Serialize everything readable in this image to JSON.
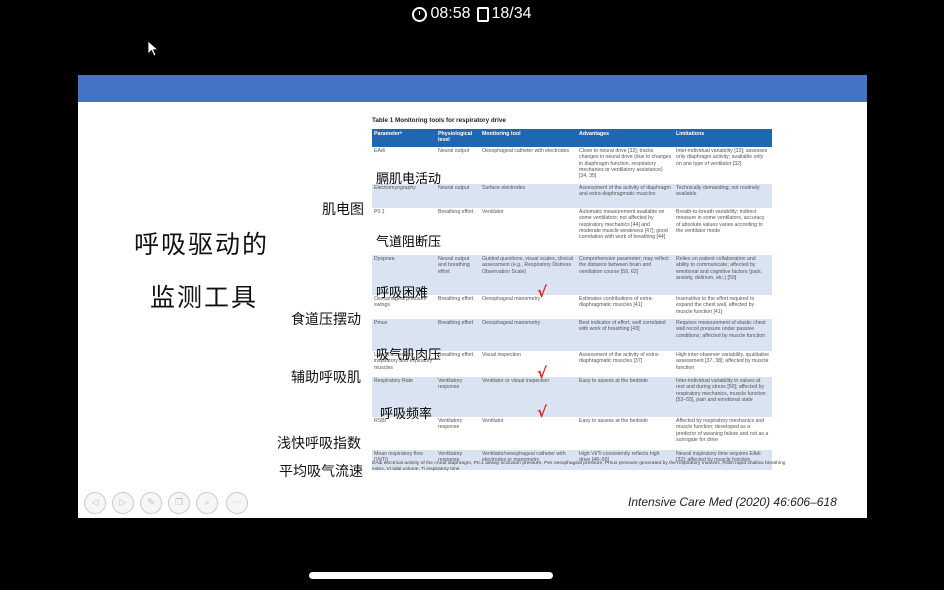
{
  "status": {
    "time": "08:58",
    "page": "18/34"
  },
  "slide": {
    "title_line1": "呼吸驱动的",
    "title_line2": "监测工具",
    "side_labels": [
      "肌电图",
      "食道压摆动",
      "辅助呼吸肌",
      "浅快呼吸指数",
      "平均吸气流速"
    ],
    "overlay_labels": [
      "膈肌电活动",
      "气道阻断压",
      "呼吸困难",
      "吸气肌肉压",
      "呼吸频率"
    ],
    "check_mark": "√",
    "citation": "Intensive Care Med (2020) 46:606–618"
  },
  "table": {
    "caption": "Table 1  Monitoring tools for respiratory drive",
    "headers": [
      "Parameterᵃ",
      "Physiological level",
      "Monitoring tool",
      "Advantages",
      "Limitations"
    ],
    "rows": [
      [
        "EAdi",
        "Neural output",
        "Oesophageal catheter with electrodes",
        "Close to neural drive [32]; tracks changes in neural drive (due to changes in diaphragm function, respiratory mechanics or ventilatory assistance) [34, 35]",
        "Inter-individual variability [33]; assesses only diaphragm activity; available only on one type of ventilator [32]"
      ],
      [
        "Electromyography",
        "Neural output",
        "Surface electrodes",
        "Assessment of the activity of diaphragm and extra-diaphragmatic muscles",
        "Technically demanding; not routinely available"
      ],
      [
        "P0.1",
        "Breathing effort",
        "Ventilator",
        "Automatic measurement available on some ventilators; not affected by respiratory mechanics [44] and moderate muscle weakness [47]; good correlation with work of breathing [44]",
        "Breath-to-breath variability; indirect measure in some ventilators, accuracy of absolute values varies according to the ventilator mode"
      ],
      [
        "Dyspnea",
        "Neural output and breathing effort",
        "Guided questions, visual scales, clinical assessment (e.g., Respiratory Distress Observation Scale)",
        "Comprehensive parameter; may reflect the distance between brain and ventilation course [59, 62]",
        "Relies on patient collaboration and ability to communicate; affected by emotional and cognitive factors (pain, anxiety, delirium, etc.) [59]"
      ],
      [
        "Oesophageal pressure swings",
        "Breathing effort",
        "Oesophageal manometry",
        "Estimates contributions of extra-diaphragmatic muscles [41]",
        "Insensitive to the effort required to expand the chest wall, affected by muscle function [41]"
      ],
      [
        "Pmus",
        "Breathing effort",
        "Oesophageal manometry",
        "Best indicator of effort, well correlated with work of breathing [43]",
        "Requires measurement of elastic chest wall recoil pressure under passive conditions; affected by muscle function"
      ],
      [
        "Use of accessory inspiratory and expiratory muscles",
        "Breathing effort",
        "Visual inspection",
        "Assessment of the activity of extra-diaphragmatic muscles [37]",
        "High inter-observer variability, qualitative assessment [37, 38]; affected by muscle function"
      ],
      [
        "Respiratory Rate",
        "Ventilatory response",
        "Ventilator or visual inspection",
        "Easy to assess at the bedside",
        "Inter-individual variability in values at rest and during stress [50]; affected by respiratory mechanics, muscle function [53–55], pain and emotional state"
      ],
      [
        "RSBI",
        "Ventilatory response",
        "Ventilator",
        "Easy to assess at the bedside",
        "Affected by respiratory mechanics and muscle function; developed as a predictor of weaning failure and not as a surrogate for drive"
      ],
      [
        "Mean inspiratory flow (Vt/Ti)",
        "Ventilatory response",
        "Ventilator/oesophageal catheter with electrodes or manometry",
        "High Vt/Ti consistently reflects high drive [48–50]",
        "Neural inspiratory time requires EAdi [32]; affected by muscle function"
      ]
    ],
    "footnote": "EAdi electrical activity of the crural diaphragm, P0.1 airway occlusion pressure, Pes oesophageal pressure, Pmus pressure generated by the respiratory muscles, RSBI rapid shallow breathing index, Vt tidal volume, Ti inspiratory time"
  },
  "toolbar": {
    "buttons": [
      {
        "icon": "prev-arrow-icon",
        "glyph": "◁"
      },
      {
        "icon": "next-arrow-icon",
        "glyph": "▷"
      },
      {
        "icon": "pen-icon",
        "glyph": "✎"
      },
      {
        "icon": "copy-icon",
        "glyph": "❐"
      },
      {
        "icon": "zoom-icon",
        "glyph": "⌕"
      },
      {
        "icon": "more-icon",
        "glyph": "⋯"
      }
    ]
  }
}
